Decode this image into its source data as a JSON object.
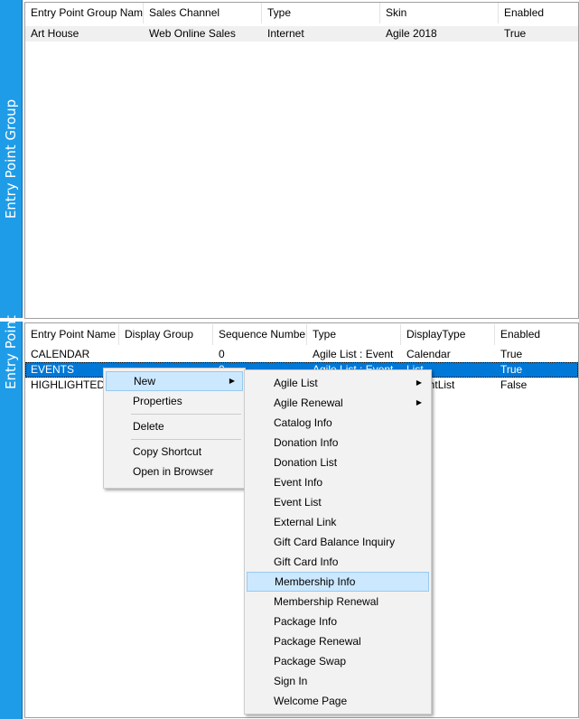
{
  "top_panel": {
    "tab_label": "Entry Point Group",
    "columns": [
      "Entry Point Group Name",
      "Sales Channel",
      "Type",
      "Skin",
      "Enabled"
    ],
    "rows": [
      [
        "Art House",
        "Web Online Sales",
        "Internet",
        "Agile 2018",
        "True"
      ]
    ]
  },
  "bottom_panel": {
    "tab_label": "Entry Point",
    "columns": [
      "Entry Point Name",
      "Display Group",
      "Sequence Number",
      "Type",
      "DisplayType",
      "Enabled"
    ],
    "rows": [
      [
        "CALENDAR",
        "",
        "0",
        "Agile List : Event",
        "Calendar",
        "True"
      ],
      [
        "EVENTS",
        "",
        "0",
        "Agile List : Event",
        "List",
        "True"
      ],
      [
        "HIGHLIGHTED",
        "",
        "",
        "",
        "HighlightList",
        "False"
      ]
    ]
  },
  "context_menu": {
    "items": [
      "New",
      "Properties",
      "Delete",
      "Copy Shortcut",
      "Open in Browser"
    ]
  },
  "submenu": {
    "items": [
      "Agile List",
      "Agile Renewal",
      "Catalog Info",
      "Donation Info",
      "Donation List",
      "Event Info",
      "Event List",
      "External Link",
      "Gift Card Balance Inquiry",
      "Gift Card Info",
      "Membership Info",
      "Membership Renewal",
      "Package Info",
      "Package Renewal",
      "Package Swap",
      "Sign In",
      "Welcome Page"
    ],
    "highlighted": "Membership Info"
  },
  "colors": {
    "tab_blue": "#1e9ce8",
    "selection": "#0078d7",
    "menu_highlight": "#cce8ff"
  }
}
